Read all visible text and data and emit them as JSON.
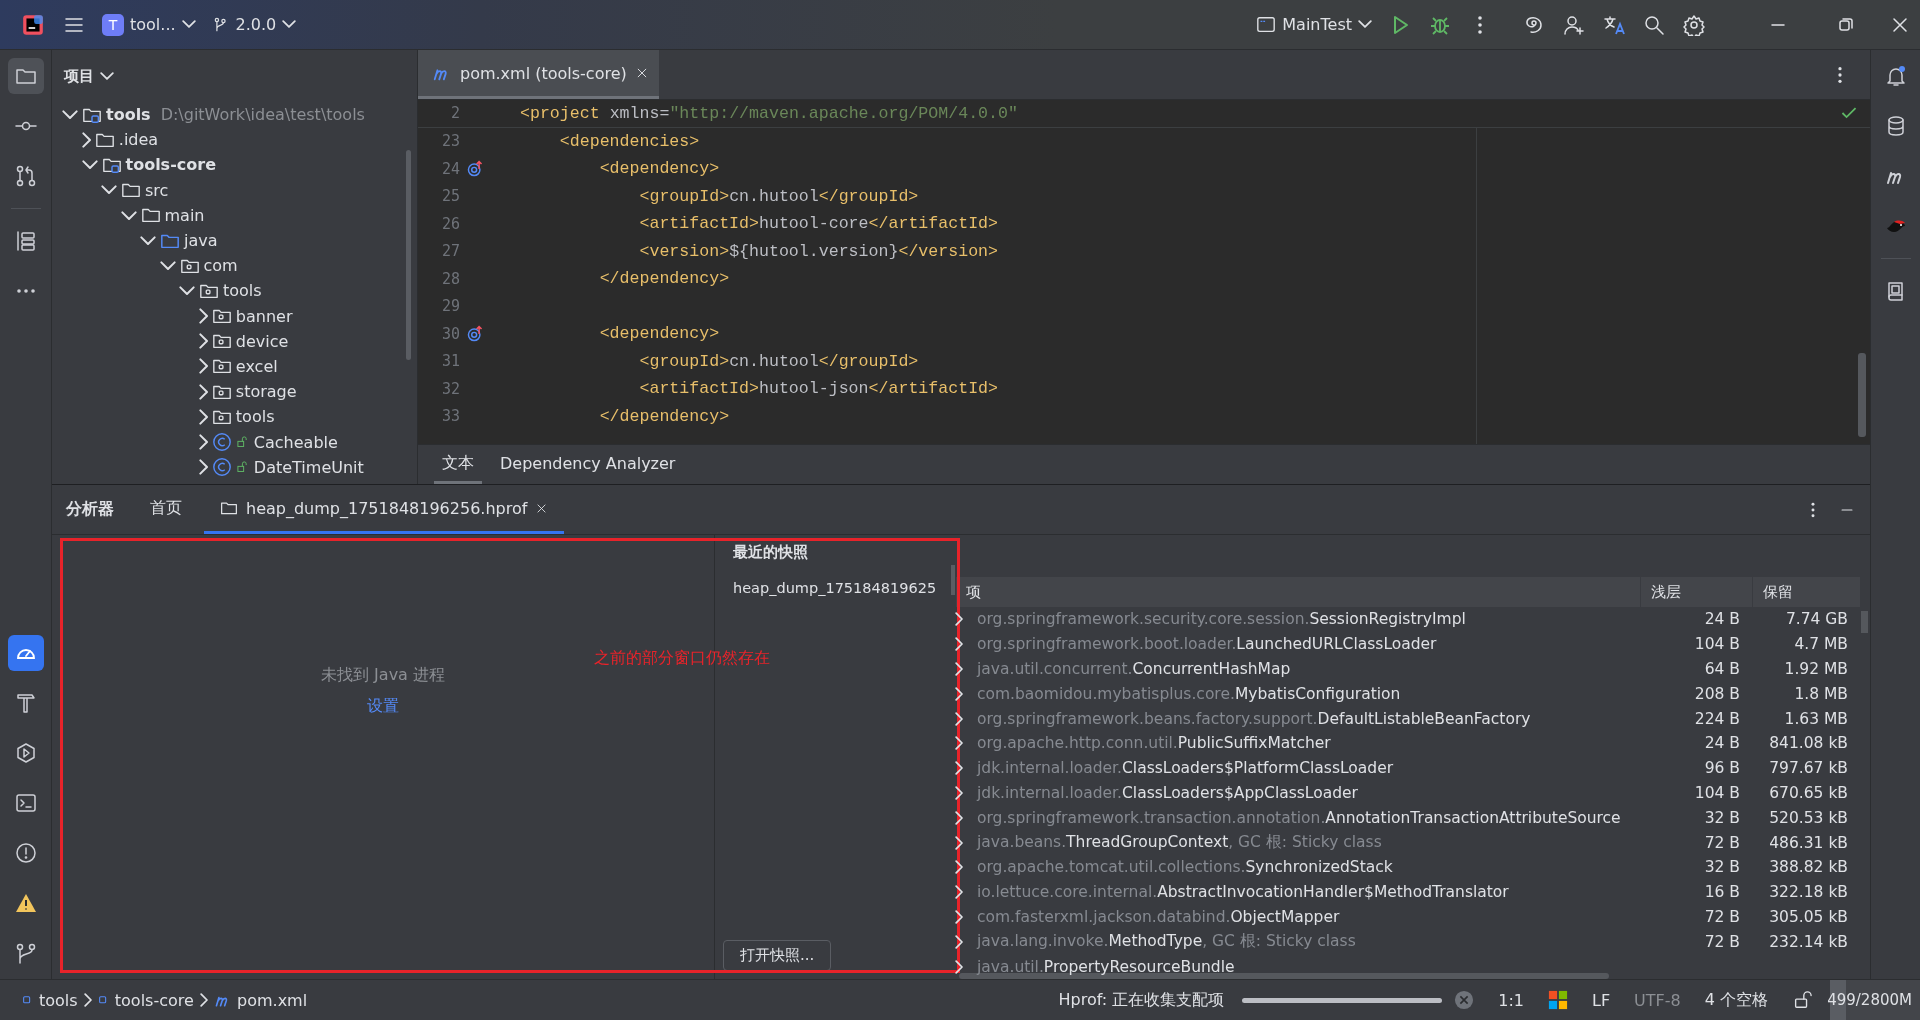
{
  "title_bar": {
    "project": {
      "badge": "T",
      "label": "tool..."
    },
    "branch": "2.0.0",
    "run_config": "MainTest"
  },
  "project_panel": {
    "title": "项目",
    "tree": [
      {
        "label": "tools",
        "kind": "module",
        "bold": true,
        "path": "D:\\gitWork\\idea\\test\\tools",
        "expanded": true,
        "children": [
          {
            "label": ".idea",
            "kind": "folder",
            "expanded": false
          },
          {
            "label": "tools-core",
            "kind": "module",
            "bold": true,
            "expanded": true,
            "children": [
              {
                "label": "src",
                "kind": "folder",
                "expanded": true,
                "children": [
                  {
                    "label": "main",
                    "kind": "folder",
                    "expanded": true,
                    "children": [
                      {
                        "label": "java",
                        "kind": "source",
                        "expanded": true,
                        "children": [
                          {
                            "label": "com",
                            "kind": "package",
                            "expanded": true,
                            "children": [
                              {
                                "label": "tools",
                                "kind": "package",
                                "expanded": true,
                                "children": [
                                  {
                                    "label": "banner",
                                    "kind": "package",
                                    "expanded": false
                                  },
                                  {
                                    "label": "device",
                                    "kind": "package",
                                    "expanded": false
                                  },
                                  {
                                    "label": "excel",
                                    "kind": "package",
                                    "expanded": false
                                  },
                                  {
                                    "label": "storage",
                                    "kind": "package",
                                    "expanded": false
                                  },
                                  {
                                    "label": "tools",
                                    "kind": "package",
                                    "expanded": false
                                  },
                                  {
                                    "label": "Cacheable",
                                    "kind": "class",
                                    "expanded": false
                                  },
                                  {
                                    "label": "DateTimeUnit",
                                    "kind": "class",
                                    "expanded": false
                                  }
                                ]
                              }
                            ]
                          }
                        ]
                      }
                    ]
                  }
                ]
              }
            ]
          }
        ]
      }
    ]
  },
  "editor": {
    "tab": {
      "label": "pom.xml (tools-core)",
      "selected": true
    },
    "sticky_line": {
      "number": "2",
      "parts": [
        {
          "kind": "tag",
          "text": "<project"
        },
        {
          "kind": "text",
          "text": " xmlns="
        },
        {
          "kind": "string",
          "text": "\"http://maven.apache.org/POM/4.0.0\""
        }
      ]
    },
    "lines": [
      {
        "number": "23",
        "marked": false,
        "parts": [
          {
            "kind": "tag",
            "text": "    <dependencies>"
          }
        ]
      },
      {
        "number": "24",
        "marked": true,
        "parts": [
          {
            "kind": "tag",
            "text": "        <dependency>"
          }
        ]
      },
      {
        "number": "25",
        "marked": false,
        "parts": [
          {
            "kind": "tag",
            "text": "            <groupId>"
          },
          {
            "kind": "text",
            "text": "cn.hutool"
          },
          {
            "kind": "tag",
            "text": "</groupId>"
          }
        ]
      },
      {
        "number": "26",
        "marked": false,
        "parts": [
          {
            "kind": "tag",
            "text": "            <artifactId>"
          },
          {
            "kind": "text",
            "text": "hutool-core"
          },
          {
            "kind": "tag",
            "text": "</artifactId>"
          }
        ]
      },
      {
        "number": "27",
        "marked": false,
        "parts": [
          {
            "kind": "tag",
            "text": "            <version>"
          },
          {
            "kind": "text",
            "text": "${hutool.version}"
          },
          {
            "kind": "tag",
            "text": "</version>"
          }
        ]
      },
      {
        "number": "28",
        "marked": false,
        "parts": [
          {
            "kind": "tag",
            "text": "        </dependency>"
          }
        ]
      },
      {
        "number": "29",
        "marked": false
      },
      {
        "number": "30",
        "marked": true,
        "parts": [
          {
            "kind": "tag",
            "text": "        <dependency>"
          }
        ]
      },
      {
        "number": "31",
        "marked": false,
        "parts": [
          {
            "kind": "tag",
            "text": "            <groupId>"
          },
          {
            "kind": "text",
            "text": "cn.hutool"
          },
          {
            "kind": "tag",
            "text": "</groupId>"
          }
        ]
      },
      {
        "number": "32",
        "marked": false,
        "parts": [
          {
            "kind": "tag",
            "text": "            <artifactId>"
          },
          {
            "kind": "text",
            "text": "hutool-json"
          },
          {
            "kind": "tag",
            "text": "</artifactId>"
          }
        ]
      },
      {
        "number": "33",
        "marked": false,
        "parts": [
          {
            "kind": "tag",
            "text": "        </dependency>"
          }
        ]
      }
    ],
    "bottom_tabs": [
      {
        "label": "文本",
        "selected": true
      },
      {
        "label": "Dependency Analyzer",
        "selected": false
      }
    ]
  },
  "profiler": {
    "title": "分析器",
    "tabs": [
      {
        "label": "首页",
        "kind": "plain",
        "selected": false
      },
      {
        "label": "heap_dump_1751848196256.hprof",
        "kind": "file",
        "selected": true
      }
    ],
    "empty_message": "未找到 Java 进程",
    "settings_link": "设置",
    "recent": {
      "title": "最近的快照",
      "items": [
        "heap_dump_175184819625"
      ],
      "open_button": "打开快照..."
    },
    "table": {
      "columns": [
        "项",
        "浅层",
        "保留"
      ],
      "rows": [
        {
          "package": "org.springframework.security.core.session.",
          "class": "SessionRegistryImpl",
          "shallow": "24 B",
          "retained": "7.74 GB"
        },
        {
          "package": "org.springframework.boot.loader.",
          "class": "LaunchedURLClassLoader",
          "shallow": "104 B",
          "retained": "4.7 MB"
        },
        {
          "package": "java.util.concurrent.",
          "class": "ConcurrentHashMap",
          "shallow": "64 B",
          "retained": "1.92 MB"
        },
        {
          "package": "com.baomidou.mybatisplus.core.",
          "class": "MybatisConfiguration",
          "shallow": "208 B",
          "retained": "1.8 MB"
        },
        {
          "package": "org.springframework.beans.factory.support.",
          "class": "DefaultListableBeanFactory",
          "shallow": "224 B",
          "retained": "1.63 MB"
        },
        {
          "package": "org.apache.http.conn.util.",
          "class": "PublicSuffixMatcher",
          "shallow": "24 B",
          "retained": "841.08 kB"
        },
        {
          "package": "jdk.internal.loader.",
          "class": "ClassLoaders$PlatformClassLoader",
          "shallow": "96 B",
          "retained": "797.67 kB"
        },
        {
          "package": "jdk.internal.loader.",
          "class": "ClassLoaders$AppClassLoader",
          "shallow": "104 B",
          "retained": "670.65 kB"
        },
        {
          "package": "org.springframework.transaction.annotation.",
          "class": "AnnotationTransactionAttributeSource",
          "shallow": "32 B",
          "retained": "520.53 kB"
        },
        {
          "package": "java.beans.",
          "class": "ThreadGroupContext",
          "suffix": ", GC 根: Sticky class",
          "shallow": "72 B",
          "retained": "486.31 kB"
        },
        {
          "package": "org.apache.tomcat.util.collections.",
          "class": "SynchronizedStack",
          "shallow": "32 B",
          "retained": "388.82 kB"
        },
        {
          "package": "io.lettuce.core.internal.",
          "class": "AbstractInvocationHandler$MethodTranslator",
          "shallow": "16 B",
          "retained": "322.18 kB"
        },
        {
          "package": "com.fasterxml.jackson.databind.",
          "class": "ObjectMapper",
          "shallow": "72 B",
          "retained": "305.05 kB"
        },
        {
          "package": "java.lang.invoke.",
          "class": "MethodType",
          "suffix": ", GC 根: Sticky class",
          "shallow": "72 B",
          "retained": "232.14 kB"
        },
        {
          "package": "java.util.",
          "class": "PropertyResourceBundle"
        }
      ]
    }
  },
  "annotation": {
    "text": "之前的部分窗口仍然存在"
  },
  "status_bar": {
    "breadcrumbs": [
      {
        "label": "tools",
        "kind": "module"
      },
      {
        "label": "tools-core",
        "kind": "module"
      },
      {
        "label": "pom.xml",
        "kind": "maven"
      }
    ],
    "task": {
      "label": "Hprof: 正在收集支配项",
      "level": 1
    },
    "position": "1:1",
    "line_ending": "LF",
    "encoding": "UTF-8",
    "indent": "4 个空格",
    "memory": {
      "label": "499/2800M",
      "level": 0.18
    }
  }
}
